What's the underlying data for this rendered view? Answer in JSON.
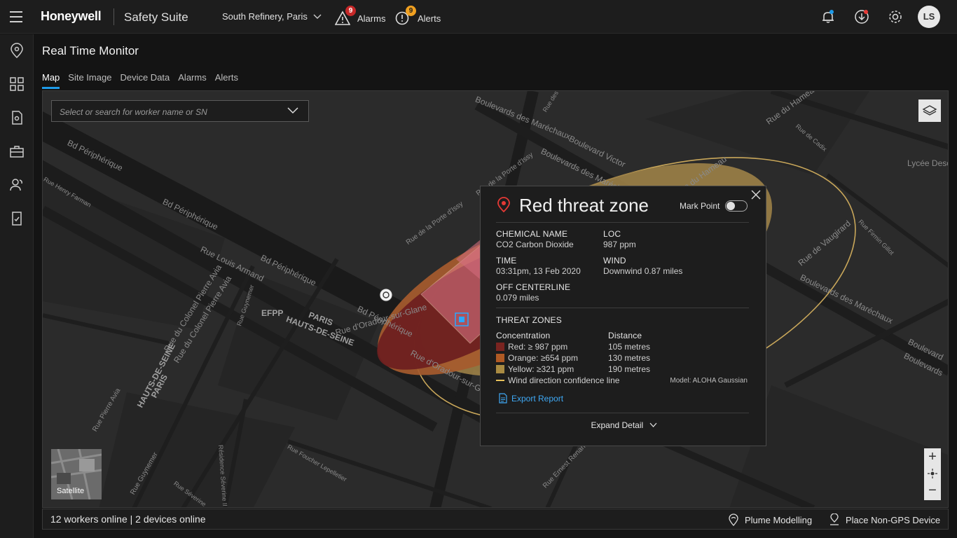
{
  "app": {
    "brand": "Honeywell",
    "suite": "Safety Suite",
    "site": "South Refinery, Paris",
    "alarms": {
      "label": "Alarms",
      "count": "9"
    },
    "alerts": {
      "label": "Alerts",
      "count": "9"
    },
    "user_initials": "LS"
  },
  "page": {
    "title": "Real Time Monitor",
    "tabs": [
      {
        "label": "Map",
        "active": true
      },
      {
        "label": "Site Image",
        "active": false
      },
      {
        "label": "Device Data",
        "active": false
      },
      {
        "label": "Alarms",
        "active": false
      },
      {
        "label": "Alerts",
        "active": false
      }
    ]
  },
  "map": {
    "search_placeholder": "Select or search for worker name or SN",
    "satellite_label": "Satellite",
    "streets": [
      "Bd Périphérique",
      "Bd Périphérique",
      "Bd Périphérique",
      "Bd Périphérique",
      "Rue Louis Armand",
      "Rue du Colonel Pierre Avia",
      "Rue du Colonel Pierre Avia",
      "Rue Henry Farman",
      "Rue Guynemer",
      "EFPP",
      "PARIS",
      "HAUTS-DE-SEINE",
      "PARIS",
      "HAUTS-DE-SEINE",
      "Rue d'Oradour-sur-Glane",
      "Rue d'Oradour-sur-Glane",
      "Boulevards des Maréchaux",
      "Boulevard Victor",
      "Boulevards des Maréchaux",
      "Rue des Maréchaux",
      "Rue du Hameau",
      "Rue de Cadix",
      "Rue du Hameau",
      "Rue de Vaugirard",
      "Rue Firmin Gillot",
      "Boulevards des Maréchaux",
      "Boulevard",
      "Boulevards",
      "Lycée Descartes",
      "Rue de la Porte d'Issy",
      "Rue de la Porte d'Issy",
      "Rue Ernest Renan",
      "Rue Foucher Lepelletier",
      "Résidence Séverine II",
      "Rue Séverine",
      "Rue Pierre Avia",
      "Rue Guynemer"
    ]
  },
  "popup": {
    "title": "Red threat zone",
    "mark_point": "Mark Point",
    "chemical_label": "CHEMICAL NAME",
    "chemical_value": "CO2 Carbon Dioxide",
    "loc_label": "LOC",
    "loc_value": "987 ppm",
    "time_label": "TIME",
    "time_value": "03:31pm, 13 Feb 2020",
    "wind_label": "WIND",
    "wind_value": "Downwind 0.87 miles",
    "offcenter_label": "OFF CENTERLINE",
    "offcenter_value": "0.079 miles",
    "zones_title": "THREAT ZONES",
    "concentration_header": "Concentration",
    "distance_header": "Distance",
    "zones": [
      {
        "label": "Red:  ≥ 987 ppm",
        "distance": "105 metres",
        "color": "#7a2420"
      },
      {
        "label": "Orange: ≥654 ppm",
        "distance": "130 metres",
        "color": "#b05a24"
      },
      {
        "label": "Yellow: ≥321 ppm",
        "distance": "190 metres",
        "color": "#a98b42"
      }
    ],
    "confidence_line": "Wind direction confidence line",
    "confidence_color": "#e8c15a",
    "model": "Model: ALOHA Gaussian",
    "export": "Export Report",
    "expand": "Expand Detail"
  },
  "footer": {
    "status": "12 workers online | 2 devices online",
    "plume": "Plume Modelling",
    "place_device": "Place Non-GPS Device"
  },
  "colors": {
    "accent": "#1e9ae8",
    "alarm_badge": "#c62828",
    "alert_badge": "#f0a020",
    "link": "#3fa9f5"
  }
}
